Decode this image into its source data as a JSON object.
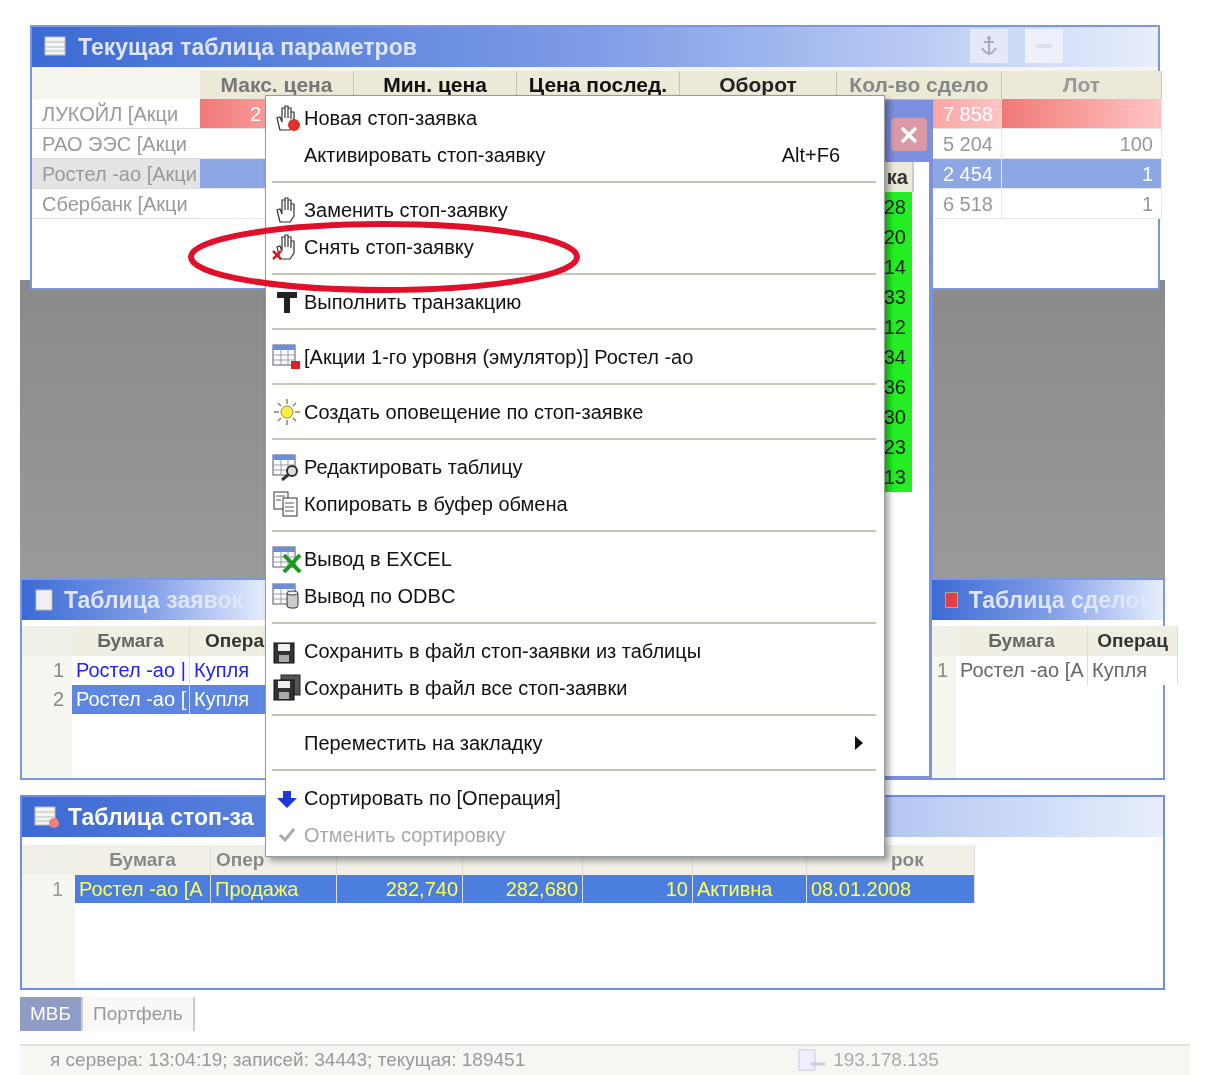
{
  "params_window": {
    "title": "Текущая таблица параметров",
    "columns": [
      "Макс. цена",
      "Мин. цена",
      "Цена послед.",
      "Оборот",
      "Кол-во сдело",
      "Лот"
    ],
    "rows": [
      {
        "name": "ЛУКОЙЛ [Акци",
        "alert": true,
        "selected": false,
        "cells": [
          "2",
          "",
          "",
          "",
          "7 858",
          ""
        ]
      },
      {
        "name": "РАО ЭЭС [Акци",
        "alert": false,
        "selected": false,
        "cells": [
          "",
          "",
          "",
          "",
          "5 204",
          "100"
        ]
      },
      {
        "name": "Ростел -ао [Акци",
        "alert": false,
        "selected": true,
        "cells": [
          "",
          "",
          "",
          "",
          "2 454",
          "1"
        ]
      },
      {
        "name": "Сбербанк [Акци",
        "alert": false,
        "selected": false,
        "cells": [
          "",
          "",
          "",
          "",
          "6 518",
          "1"
        ]
      }
    ]
  },
  "hidden_window": {
    "column_header": "ка",
    "values": [
      "28",
      "20",
      "14",
      "33",
      "12",
      "34",
      "36",
      "30",
      "23",
      "13"
    ]
  },
  "orders_window": {
    "title": "Таблица заявок",
    "columns": [
      "Бумага",
      "Опера"
    ],
    "rows": [
      {
        "number": "1",
        "selected": false,
        "cells": [
          "Ростел -ао |",
          "Купля"
        ]
      },
      {
        "number": "2",
        "selected": true,
        "cells": [
          "Ростел -ао [",
          "Купля"
        ]
      }
    ]
  },
  "deals_window": {
    "title": "Таблица сделок",
    "columns": [
      "Бумага",
      "Операц"
    ],
    "rows": [
      {
        "number": "1",
        "selected": false,
        "cells": [
          "Ростел -ао [А",
          "Купля"
        ]
      }
    ]
  },
  "stop_window": {
    "title": "Таблица стоп-за",
    "columns": [
      "Бумага",
      "Опер",
      "",
      "",
      "",
      "",
      "рок"
    ],
    "rows": [
      {
        "number": "1",
        "selected": true,
        "cells": [
          "Ростел -ао [А",
          "Продажа",
          "282,740",
          "282,680",
          "10",
          "Активна",
          "08.01.2008"
        ]
      }
    ]
  },
  "context_menu": {
    "items": [
      {
        "kind": "item",
        "label": "Новая стоп-заявка",
        "disabled": false,
        "checked": false,
        "submenu": false
      },
      {
        "kind": "item",
        "label": "Активировать стоп-заявку",
        "shortcut": "Alt+F6",
        "disabled": false,
        "checked": false,
        "submenu": false
      },
      {
        "kind": "separator"
      },
      {
        "kind": "item",
        "label": "Заменить стоп-заявку",
        "disabled": false,
        "checked": false,
        "submenu": false
      },
      {
        "kind": "item",
        "label": "Снять стоп-заявку",
        "disabled": false,
        "checked": false,
        "submenu": false,
        "circled": true
      },
      {
        "kind": "separator"
      },
      {
        "kind": "item",
        "label": "Выполнить транзакцию",
        "disabled": false,
        "checked": false,
        "submenu": false
      },
      {
        "kind": "separator"
      },
      {
        "kind": "item",
        "label": "[Акции 1-го уровня (эмулятор)] Ростел -ао",
        "disabled": false,
        "checked": false,
        "submenu": false
      },
      {
        "kind": "separator"
      },
      {
        "kind": "item",
        "label": "Создать оповещение по стоп-заявке",
        "disabled": false,
        "checked": false,
        "submenu": false
      },
      {
        "kind": "separator"
      },
      {
        "kind": "item",
        "label": "Редактировать таблицу",
        "disabled": false,
        "checked": false,
        "submenu": false
      },
      {
        "kind": "item",
        "label": "Копировать в буфер обмена",
        "disabled": false,
        "checked": false,
        "submenu": false
      },
      {
        "kind": "separator"
      },
      {
        "kind": "item",
        "label": "Вывод в EXCEL",
        "disabled": false,
        "checked": false,
        "submenu": false
      },
      {
        "kind": "item",
        "label": "Вывод по ODBC",
        "disabled": false,
        "checked": false,
        "submenu": false
      },
      {
        "kind": "separator"
      },
      {
        "kind": "item",
        "label": "Сохранить в файл стоп-заявки из таблицы",
        "disabled": false,
        "checked": false,
        "submenu": false
      },
      {
        "kind": "item",
        "label": "Сохранить в файл все стоп-заявки",
        "disabled": false,
        "checked": false,
        "submenu": false
      },
      {
        "kind": "separator"
      },
      {
        "kind": "item",
        "label": "Переместить на закладку",
        "disabled": false,
        "checked": false,
        "submenu": true
      },
      {
        "kind": "separator"
      },
      {
        "kind": "item",
        "label": "Сортировать по [Операция]",
        "disabled": false,
        "checked": false,
        "submenu": false
      },
      {
        "kind": "item",
        "label": "Отменить сортировку",
        "disabled": true,
        "checked": true,
        "submenu": false
      }
    ]
  },
  "tabs": [
    {
      "label": "МВБ",
      "selected": true
    },
    {
      "label": "Портфель",
      "selected": false
    }
  ],
  "status_bar": {
    "text": "я сервера: 13:04:19; записей: 34443; текущая: 189451",
    "address": "193.178.135"
  }
}
